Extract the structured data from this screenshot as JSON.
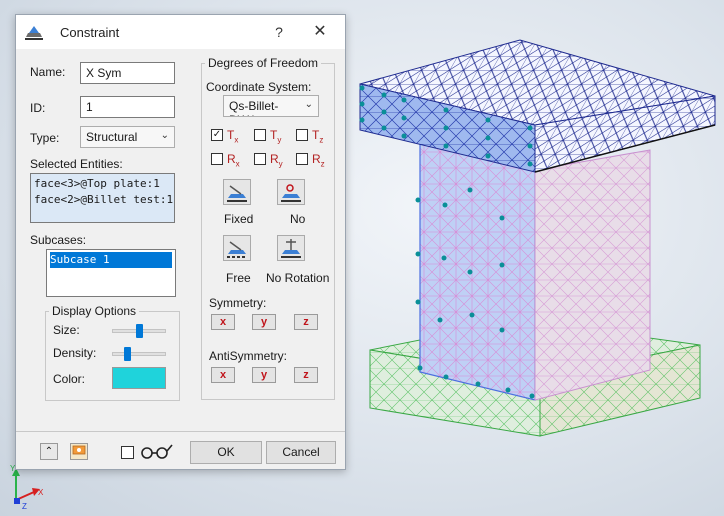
{
  "dialog": {
    "title": "Constraint",
    "help_label": "?",
    "close_label": "✕",
    "name_label": "Name:",
    "name_value": "X Sym",
    "id_label": "ID:",
    "id_value": "1",
    "type_label": "Type:",
    "type_value": "Structural",
    "selected_entities_label": "Selected Entities:",
    "selected_entities": [
      "face<3>@Top plate:1",
      "face<2>@Billet test:1"
    ],
    "subcases_label": "Subcases:",
    "subcases": [
      "Subcase 1"
    ],
    "display_options": {
      "title": "Display Options",
      "size_label": "Size:",
      "size_value": 0.5,
      "density_label": "Density:",
      "density_value": 0.25,
      "color_label": "Color:",
      "color": "#1fd3db"
    },
    "dof": {
      "title": "Degrees of Freedom",
      "coord_label": "Coordinate System:",
      "coord_value": "Qs-Billet-DW.iar",
      "translations": [
        {
          "letter": "T",
          "sub": "x",
          "checked": true
        },
        {
          "letter": "T",
          "sub": "y",
          "checked": false
        },
        {
          "letter": "T",
          "sub": "z",
          "checked": false
        }
      ],
      "rotations": [
        {
          "letter": "R",
          "sub": "x",
          "checked": false
        },
        {
          "letter": "R",
          "sub": "y",
          "checked": false
        },
        {
          "letter": "R",
          "sub": "z",
          "checked": false
        }
      ],
      "presets": [
        "Fixed",
        "No",
        "Free",
        "No Rotation"
      ],
      "symmetry_label": "Symmetry:",
      "antisymmetry_label": "AntiSymmetry:",
      "axes": [
        "x",
        "y",
        "z"
      ]
    },
    "footer": {
      "ok_label": "OK",
      "cancel_label": "Cancel",
      "collapse_glyph": "≈"
    }
  },
  "triad": {
    "y_label": "Y",
    "x_label": "X",
    "z_label": "Z"
  },
  "colors": {
    "accent": "#0078d7",
    "symmetry_text": "#c0141b",
    "mesh_top": "#1e2a8f",
    "mesh_face": "#b6c8f2"
  }
}
